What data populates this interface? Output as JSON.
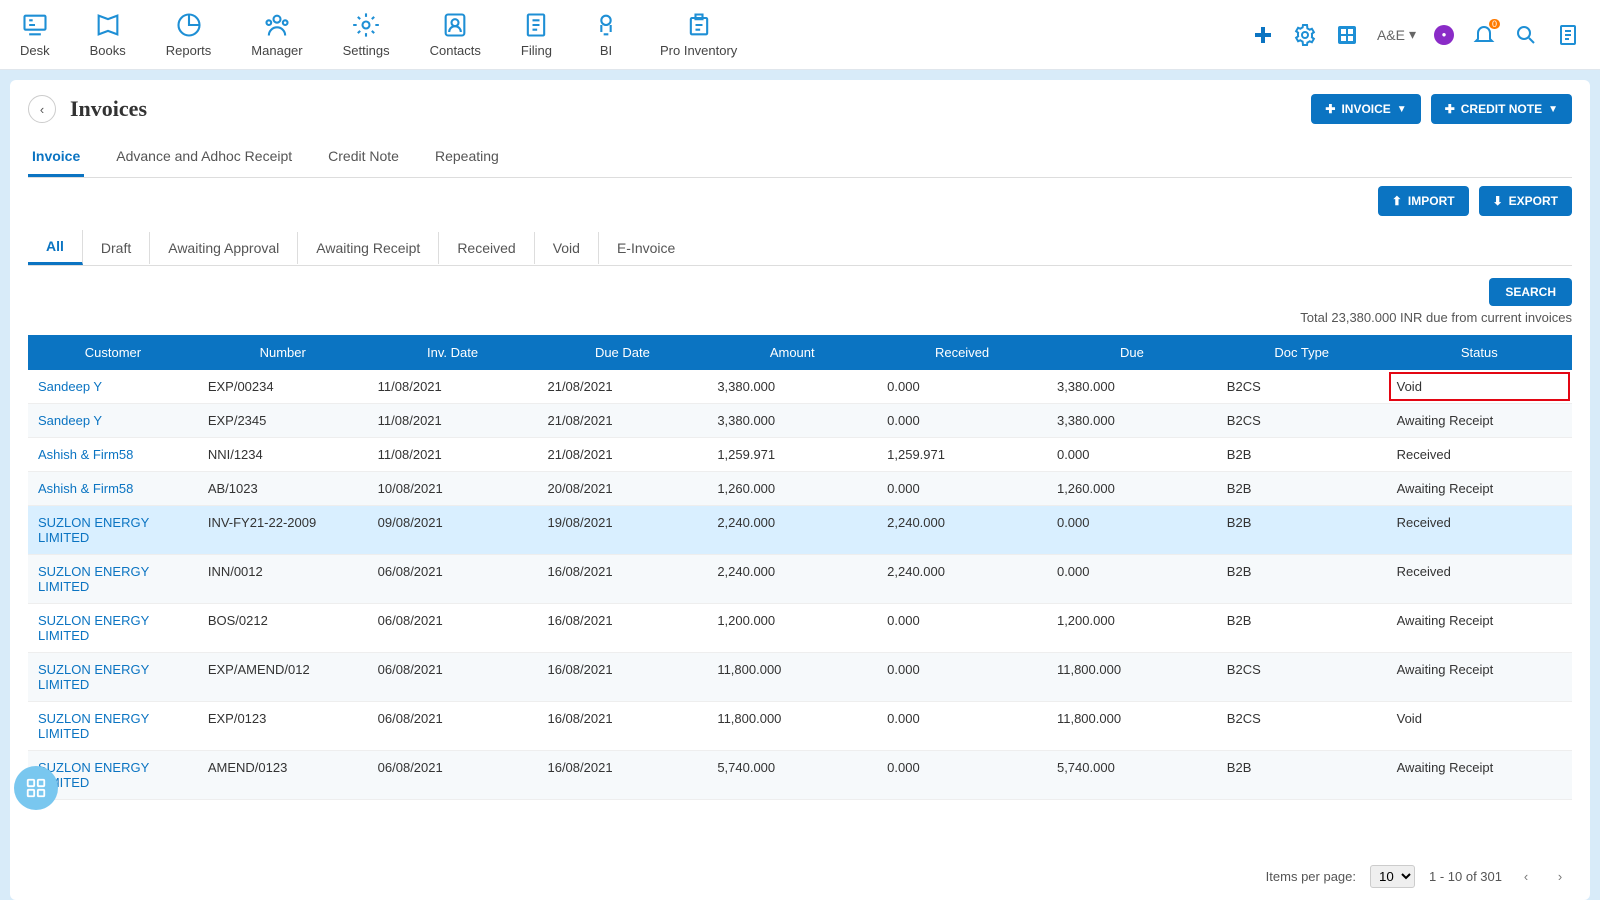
{
  "nav": {
    "items": [
      {
        "id": "desk",
        "label": "Desk"
      },
      {
        "id": "books",
        "label": "Books"
      },
      {
        "id": "reports",
        "label": "Reports"
      },
      {
        "id": "manager",
        "label": "Manager"
      },
      {
        "id": "settings",
        "label": "Settings"
      },
      {
        "id": "contacts",
        "label": "Contacts"
      },
      {
        "id": "filing",
        "label": "Filing"
      },
      {
        "id": "bi",
        "label": "BI"
      },
      {
        "id": "proinv",
        "label": "Pro Inventory"
      }
    ],
    "org": "A&E",
    "notif": "0"
  },
  "header": {
    "title": "Invoices",
    "invoice_label": "INVOICE",
    "credit_label": "CREDIT NOTE",
    "import_label": "IMPORT",
    "export_label": "EXPORT"
  },
  "tabs1": [
    {
      "label": "Invoice",
      "active": true
    },
    {
      "label": "Advance and Adhoc Receipt"
    },
    {
      "label": "Credit Note"
    },
    {
      "label": "Repeating"
    }
  ],
  "tabs2": [
    {
      "label": "All",
      "active": true
    },
    {
      "label": "Draft"
    },
    {
      "label": "Awaiting Approval"
    },
    {
      "label": "Awaiting Receipt"
    },
    {
      "label": "Received"
    },
    {
      "label": "Void"
    },
    {
      "label": "E-Invoice"
    }
  ],
  "search_label": "SEARCH",
  "summary": "Total 23,380.000 INR due from current invoices",
  "columns": [
    "Customer",
    "Number",
    "Inv. Date",
    "Due Date",
    "Amount",
    "Received",
    "Due",
    "Doc Type",
    "Status"
  ],
  "rows": [
    {
      "customer": "Sandeep Y",
      "number": "EXP/00234",
      "inv": "11/08/2021",
      "due": "21/08/2021",
      "amount": "3,380.000",
      "received": "0.000",
      "duev": "3,380.000",
      "doc": "B2CS",
      "status": "Void",
      "status_hl": true
    },
    {
      "customer": "Sandeep Y",
      "number": "EXP/2345",
      "inv": "11/08/2021",
      "due": "21/08/2021",
      "amount": "3,380.000",
      "received": "0.000",
      "duev": "3,380.000",
      "doc": "B2CS",
      "status": "Awaiting Receipt"
    },
    {
      "customer": "Ashish & Firm58",
      "number": "NNI/1234",
      "inv": "11/08/2021",
      "due": "21/08/2021",
      "amount": "1,259.971",
      "received": "1,259.971",
      "duev": "0.000",
      "doc": "B2B",
      "status": "Received"
    },
    {
      "customer": "Ashish & Firm58",
      "number": "AB/1023",
      "inv": "10/08/2021",
      "due": "20/08/2021",
      "amount": "1,260.000",
      "received": "0.000",
      "duev": "1,260.000",
      "doc": "B2B",
      "status": "Awaiting Receipt"
    },
    {
      "customer": "SUZLON ENERGY LIMITED",
      "number": "INV-FY21-22-2009",
      "inv": "09/08/2021",
      "due": "19/08/2021",
      "amount": "2,240.000",
      "received": "2,240.000",
      "duev": "0.000",
      "doc": "B2B",
      "status": "Received",
      "hl": true
    },
    {
      "customer": "SUZLON ENERGY LIMITED",
      "number": "INN/0012",
      "inv": "06/08/2021",
      "due": "16/08/2021",
      "amount": "2,240.000",
      "received": "2,240.000",
      "duev": "0.000",
      "doc": "B2B",
      "status": "Received"
    },
    {
      "customer": "SUZLON ENERGY LIMITED",
      "number": "BOS/0212",
      "inv": "06/08/2021",
      "due": "16/08/2021",
      "amount": "1,200.000",
      "received": "0.000",
      "duev": "1,200.000",
      "doc": "B2B",
      "status": "Awaiting Receipt"
    },
    {
      "customer": "SUZLON ENERGY LIMITED",
      "number": "EXP/AMEND/012",
      "inv": "06/08/2021",
      "due": "16/08/2021",
      "amount": "11,800.000",
      "received": "0.000",
      "duev": "11,800.000",
      "doc": "B2CS",
      "status": "Awaiting Receipt"
    },
    {
      "customer": "SUZLON ENERGY LIMITED",
      "number": "EXP/0123",
      "inv": "06/08/2021",
      "due": "16/08/2021",
      "amount": "11,800.000",
      "received": "0.000",
      "duev": "11,800.000",
      "doc": "B2CS",
      "status": "Void"
    },
    {
      "customer": "SUZLON ENERGY LIMITED",
      "number": "AMEND/0123",
      "inv": "06/08/2021",
      "due": "16/08/2021",
      "amount": "5,740.000",
      "received": "0.000",
      "duev": "5,740.000",
      "doc": "B2B",
      "status": "Awaiting Receipt"
    }
  ],
  "pager": {
    "label": "Items per page:",
    "size": "10",
    "range": "1 - 10 of 301"
  }
}
